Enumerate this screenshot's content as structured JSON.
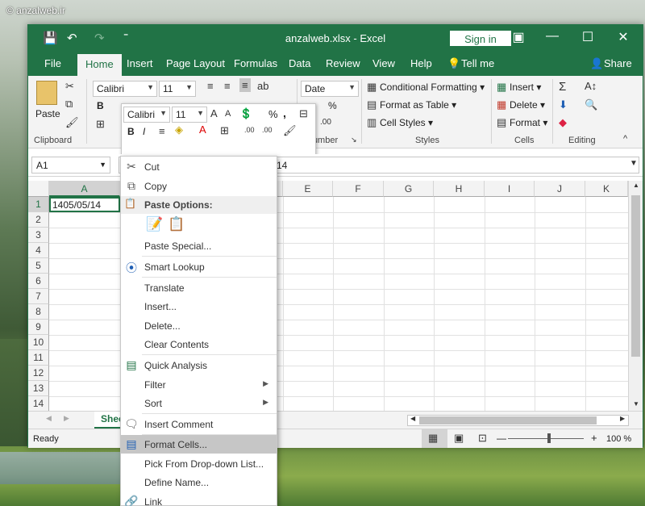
{
  "watermark": "© anzalweb.ir",
  "top_overlay_text": "...",
  "window": {
    "title": "anzalweb.xlsx  -  Excel",
    "sign_in": "Sign in",
    "minimize": "—",
    "restore": "☐",
    "close": "✕",
    "quick_access": {
      "save": "💾",
      "undo": "↶",
      "redo": "↷",
      "customize": "⁼"
    }
  },
  "tabs": [
    "File",
    "Home",
    "Insert",
    "Page Layout",
    "Formulas",
    "Data",
    "Review",
    "View",
    "Help"
  ],
  "tell_me": "Tell me",
  "share": "Share",
  "ribbon": {
    "clipboard": {
      "label": "Clipboard",
      "paste": "Paste"
    },
    "font": {
      "name": "Calibri",
      "size": "11",
      "bold": "B",
      "italic": "I",
      "underline": "U"
    },
    "number": {
      "format": "Date",
      "label": "Number",
      "percent": "%"
    },
    "styles": {
      "label": "Styles",
      "conditional": "Conditional Formatting",
      "format_table": "Format as Table",
      "cell_styles": "Cell Styles"
    },
    "cells": {
      "label": "Cells",
      "insert": "Insert",
      "delete": "Delete",
      "format": "Format"
    },
    "editing": {
      "label": "Editing",
      "sum": "Σ"
    }
  },
  "mini_toolbar": {
    "font": "Calibri",
    "size": "11",
    "bold": "B",
    "italic": "I",
    "percent": "%",
    "comma": ","
  },
  "formula_bar": {
    "name_box": "A1",
    "formula": "14"
  },
  "columns": [
    "A",
    "B",
    "C",
    "D",
    "E",
    "F",
    "G",
    "H",
    "I",
    "J",
    "K"
  ],
  "rows": [
    "1",
    "2",
    "3",
    "4",
    "5",
    "6",
    "7",
    "8",
    "9",
    "10",
    "11",
    "12",
    "13",
    "14"
  ],
  "cell_a1": "1405/05/14",
  "sheet_tab": "Shee",
  "status": {
    "ready": "Ready",
    "zoom": "100 %",
    "minus": "—",
    "plus": "+"
  },
  "context_menu": {
    "cut": "Cut",
    "copy": "Copy",
    "paste_options": "Paste Options:",
    "paste_special": "Paste Special...",
    "smart_lookup": "Smart Lookup",
    "translate": "Translate",
    "insert": "Insert...",
    "delete": "Delete...",
    "clear_contents": "Clear Contents",
    "quick_analysis": "Quick Analysis",
    "filter": "Filter",
    "sort": "Sort",
    "insert_comment": "Insert Comment",
    "format_cells": "Format Cells...",
    "pick_dropdown": "Pick From Drop-down List...",
    "define_name": "Define Name...",
    "link": "Link"
  },
  "colors": {
    "excel_green": "#217346",
    "highlight": "#c6c6c6"
  }
}
